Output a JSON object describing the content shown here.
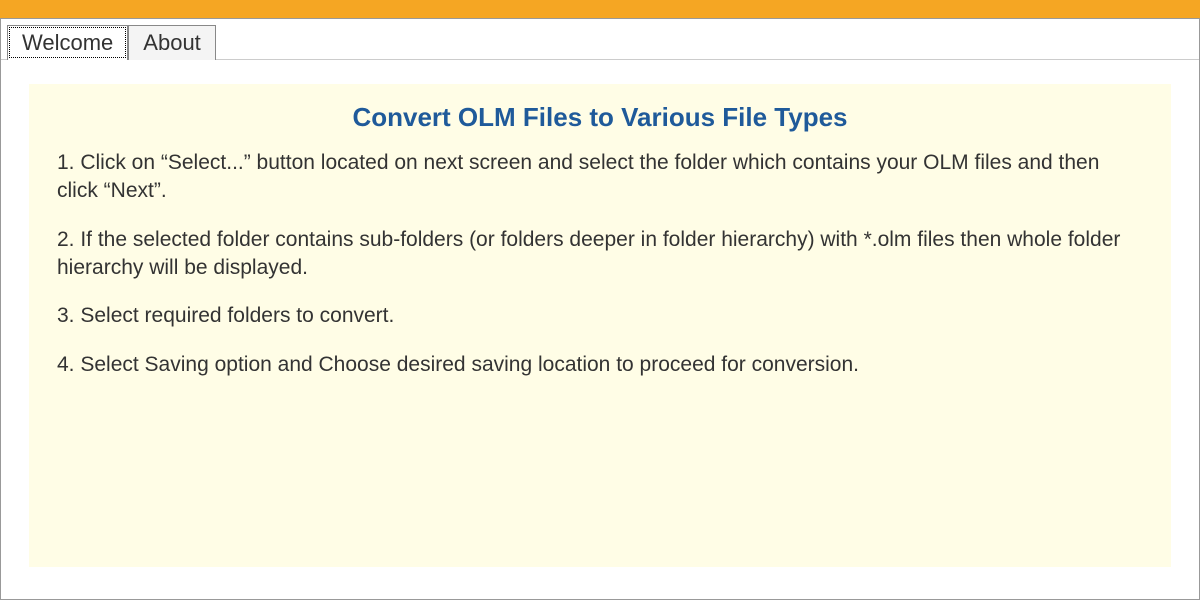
{
  "tabs": {
    "welcome": "Welcome",
    "about": "About"
  },
  "panel": {
    "title": "Convert OLM Files to Various File Types",
    "steps": [
      "1. Click on “Select...” button located on next screen and select the folder which contains your OLM files and then click “Next”.",
      "2. If the selected folder contains sub-folders (or folders deeper in folder hierarchy) with *.olm files then whole folder hierarchy will be displayed.",
      "3. Select required folders to convert.",
      "4. Select Saving option and Choose desired saving location to proceed for conversion."
    ]
  },
  "colors": {
    "titleBar": "#f5a623",
    "panelBg": "#fffde6",
    "headingColor": "#1f5a9a"
  }
}
